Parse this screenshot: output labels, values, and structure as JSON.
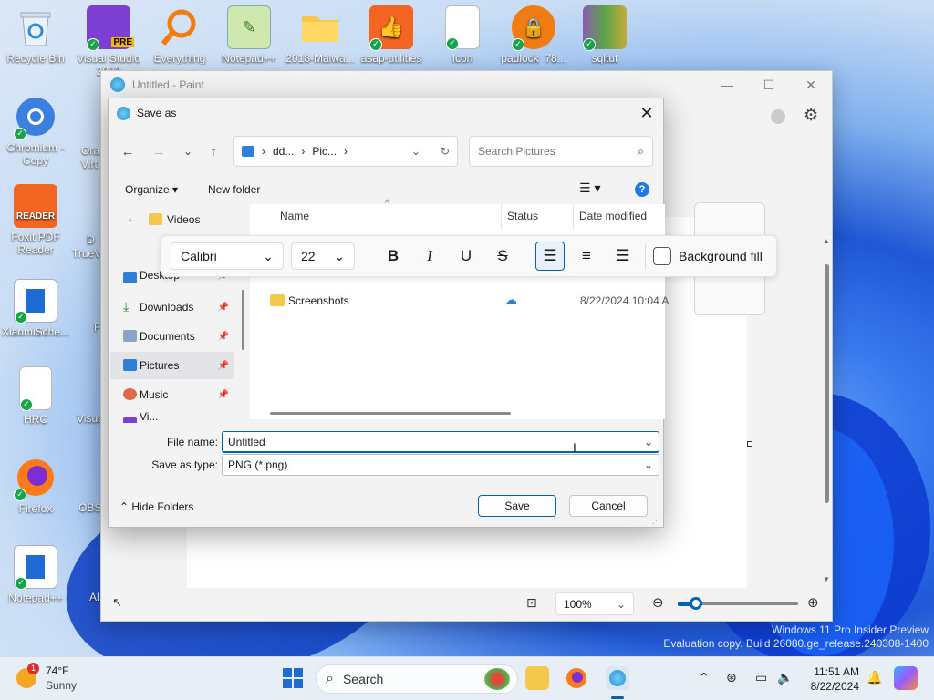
{
  "desktop": {
    "icons": [
      {
        "label": "Recycle Bin"
      },
      {
        "label": "Visual Studio 2022"
      },
      {
        "label": "Everything"
      },
      {
        "label": "Notepad++"
      },
      {
        "label": "2018-Malwa..."
      },
      {
        "label": "asap-utilities"
      },
      {
        "label": "Icon"
      },
      {
        "label": "padlock_78..."
      },
      {
        "label": "sqltut"
      },
      {
        "label": "Chromium - Copy"
      },
      {
        "label": "Foxit PDF Reader"
      },
      {
        "label": "XiaomiSche..."
      },
      {
        "label": "HRC"
      },
      {
        "label": "Firefox"
      },
      {
        "label": "Notepad++"
      }
    ],
    "partial_labels": [
      "Ora",
      "Virt",
      "D",
      "TrueV",
      "F",
      "Visua",
      "OBS",
      "Al"
    ],
    "vs_badge": "PRE",
    "foxit_badge": "READER",
    "watermark": [
      "Windows 11 Pro Insider Preview",
      "Evaluation copy. Build 26080.ge_release.240308-1400"
    ]
  },
  "paint": {
    "title": "Untitled - Paint",
    "zoom": "100%",
    "zoom_level_fraction": 0.15
  },
  "text_toolbar": {
    "font": "Calibri",
    "size": "22",
    "bold": "B",
    "italic": "I",
    "underline": "U",
    "strike": "S",
    "background_fill": "Background fill"
  },
  "dialog": {
    "title": "Save as",
    "breadcrumb": [
      "dd...",
      "Pic..."
    ],
    "search_placeholder": "Search Pictures",
    "organize": "Organize",
    "new_folder": "New folder",
    "help": "?",
    "nav_items": [
      {
        "label": "Videos"
      },
      {
        "label": "Desktop"
      },
      {
        "label": "Downloads"
      },
      {
        "label": "Documents"
      },
      {
        "label": "Pictures"
      },
      {
        "label": "Music"
      },
      {
        "label": "Vi..."
      }
    ],
    "columns": {
      "name": "Name",
      "status": "Status",
      "date": "Date modified"
    },
    "files": [
      {
        "name": "Screenshots",
        "date": "8/22/2024 10:04 A"
      }
    ],
    "file_name_label": "File name:",
    "file_name_value": "Untitled",
    "save_type_label": "Save as type:",
    "save_type_value": "PNG (*.png)",
    "hide_folders": "Hide Folders",
    "save": "Save",
    "cancel": "Cancel"
  },
  "taskbar": {
    "weather_temp": "74°F",
    "weather_desc": "Sunny",
    "weather_badge": "1",
    "search": "Search",
    "time": "11:51 AM",
    "date": "8/22/2024"
  },
  "colors": {
    "accent": "#0063b1",
    "folder": "#f5c84c",
    "ok_badge": "#16a34a"
  }
}
